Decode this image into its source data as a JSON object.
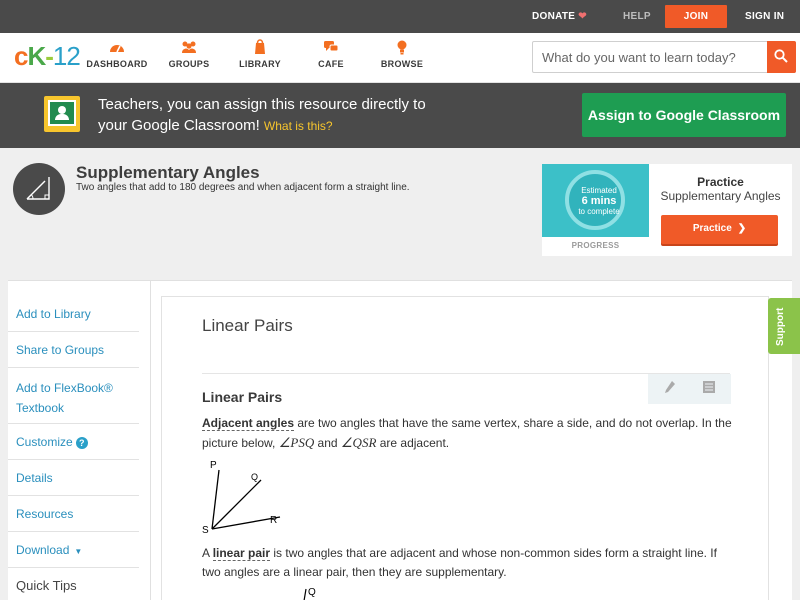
{
  "topbar": {
    "donate": "DONATE",
    "help": "HELP",
    "join": "JOIN",
    "signin": "SIGN IN"
  },
  "nav": {
    "logo": {
      "c": "c",
      "k": "K",
      "dash": "-",
      "num": "12"
    },
    "items": [
      {
        "label": "DASHBOARD",
        "icon": "dashboard-icon"
      },
      {
        "label": "GROUPS",
        "icon": "groups-icon"
      },
      {
        "label": "LIBRARY",
        "icon": "library-icon"
      },
      {
        "label": "CAFE",
        "icon": "cafe-icon"
      },
      {
        "label": "BROWSE",
        "icon": "browse-icon"
      }
    ],
    "search_placeholder": "What do you want to learn today?"
  },
  "banner": {
    "text": "Teachers, you can assign this resource directly to your Google Classroom!",
    "link": "What is this?",
    "button": "Assign to Google Classroom"
  },
  "concept": {
    "title": "Supplementary Angles",
    "description": "Two angles that add to 180 degrees and when adjacent form a straight line."
  },
  "practice": {
    "estimated": "Estimated",
    "mins": "6 mins",
    "to_complete": "to complete",
    "progress": "PROGRESS",
    "heading": "Practice",
    "subtitle": "Supplementary Angles",
    "button": "Practice"
  },
  "sidebar": {
    "items": [
      "Add to Library",
      "Share to Groups",
      "Add to FlexBook® Textbook",
      "Customize",
      "Details",
      "Resources",
      "Download",
      "Quick Tips"
    ],
    "customize_help": "?"
  },
  "lesson": {
    "title": "Linear Pairs",
    "section_title": "Linear Pairs",
    "p1_term": "Adjacent angles",
    "p1_a": " are two angles that have the same vertex, share a side, and do not overlap. In the picture below, ",
    "p1_m1": "∠PSQ",
    "p1_and": " and ",
    "p1_m2": "∠QSR",
    "p1_b": " are adjacent.",
    "diagram_labels": {
      "p": "P",
      "q": "Q",
      "r": "R",
      "s": "S"
    },
    "p2_a": "A ",
    "p2_term": "linear pair",
    "p2_b": " is two angles that are adjacent and whose non-common sides form a straight line. If two angles are a linear pair, then they are supplementary.",
    "diagram2_label": "Q"
  },
  "support": "Support",
  "colors": {
    "orange": "#f05a28",
    "green": "#1e9d52",
    "dark": "#4a4a4a",
    "link": "#2a8fbd",
    "support_green": "#8bc34a"
  }
}
